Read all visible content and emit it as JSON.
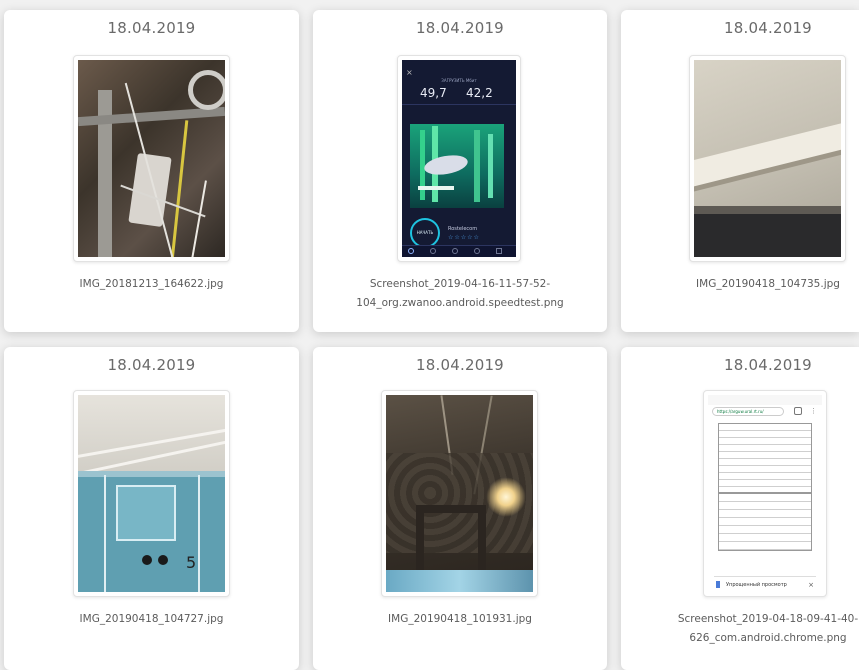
{
  "gallery": {
    "items": [
      {
        "date": "18.04.2019",
        "filename_line1": "IMG_20181213_164622.jpg",
        "filename_line2": ""
      },
      {
        "date": "18.04.2019",
        "filename_line1": "Screenshot_2019-04-16-11-57-52-",
        "filename_line2": "104_org.zwanoo.android.speedtest.png"
      },
      {
        "date": "18.04.2019",
        "filename_line1": "IMG_20190418_104735.jpg",
        "filename_line2": ""
      },
      {
        "date": "18.04.2019",
        "filename_line1": "IMG_20190418_104727.jpg",
        "filename_line2": ""
      },
      {
        "date": "18.04.2019",
        "filename_line1": "IMG_20190418_101931.jpg",
        "filename_line2": ""
      },
      {
        "date": "18.04.2019",
        "filename_line1": "Screenshot_2019-04-18-09-41-40-",
        "filename_line2": "626_com.android.chrome.png"
      }
    ]
  },
  "speedtest": {
    "download_label": "ЗАГРУЗИТЬ Мбит",
    "upload_label": "ЗАГРУЗИТЬ Мбит",
    "download_value": "49,7",
    "upload_value": "42,2",
    "button_label": "НАЧАТЬ",
    "provider": "Rostelecom"
  },
  "chrome_screenshot": {
    "url": "https://arguw.ural.rt.ru/",
    "bottom_bar": "Упрощенный просмотр"
  }
}
